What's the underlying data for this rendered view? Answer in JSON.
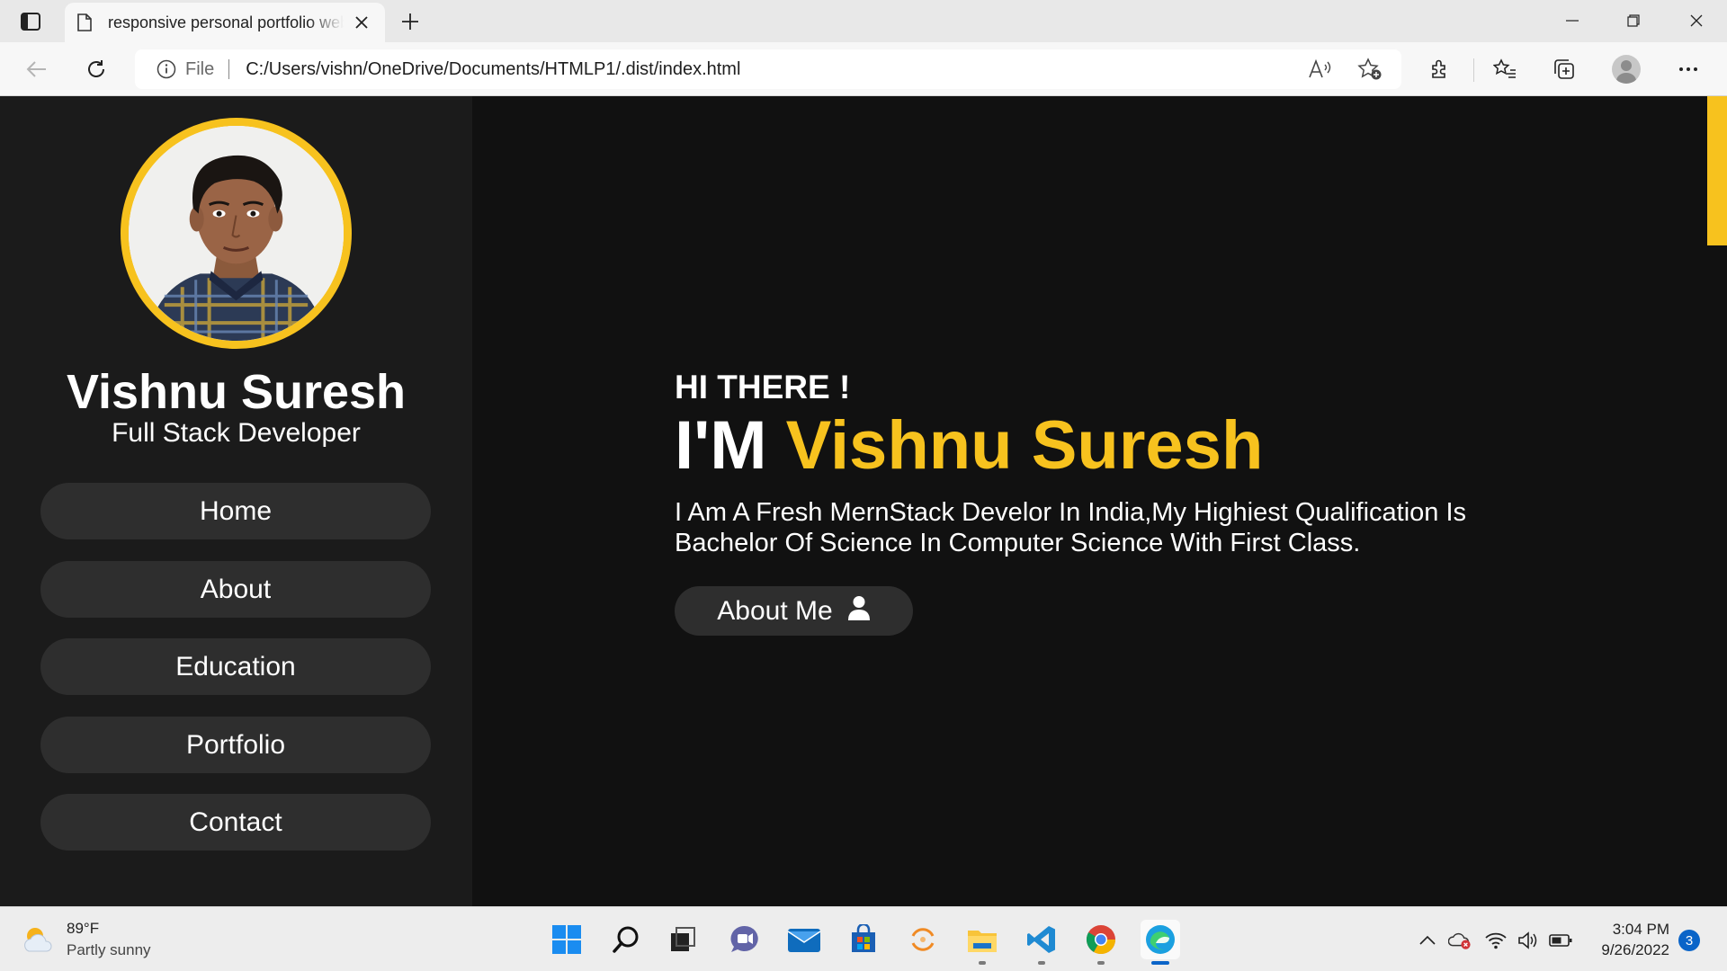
{
  "browser": {
    "tab_title": "responsive personal portfolio website",
    "address_scheme": "File",
    "address_url": "C:/Users/vishn/OneDrive/Documents/HTMLP1/.dist/index.html"
  },
  "sidebar": {
    "name": "Vishnu Suresh",
    "role": "Full Stack Developer",
    "nav": [
      {
        "label": "Home"
      },
      {
        "label": "About"
      },
      {
        "label": "Education"
      },
      {
        "label": "Portfolio"
      },
      {
        "label": "Contact"
      }
    ]
  },
  "hero": {
    "greeting": "HI THERE !",
    "im_prefix": "I'M",
    "name": "Vishnu Suresh",
    "description": "I Am A Fresh MernStack Develor In India,My Highiest Qualification Is Bachelor Of Science In Computer Science With First Class.",
    "button_label": "About Me",
    "button_icon": "user-icon"
  },
  "colors": {
    "accent": "#f7c21e",
    "page_bg": "#111111",
    "sidebar_bg": "#1b1b1b",
    "button_bg": "#2e2e2e"
  },
  "taskbar": {
    "weather_temp": "89°F",
    "weather_desc": "Partly sunny",
    "time": "3:04 PM",
    "date": "9/26/2022",
    "notification_count": "3",
    "apps": [
      "start",
      "search",
      "task-view",
      "teams-chat",
      "mail",
      "microsoft-store",
      "spinner-app",
      "file-explorer",
      "vscode",
      "chrome",
      "edge"
    ]
  }
}
